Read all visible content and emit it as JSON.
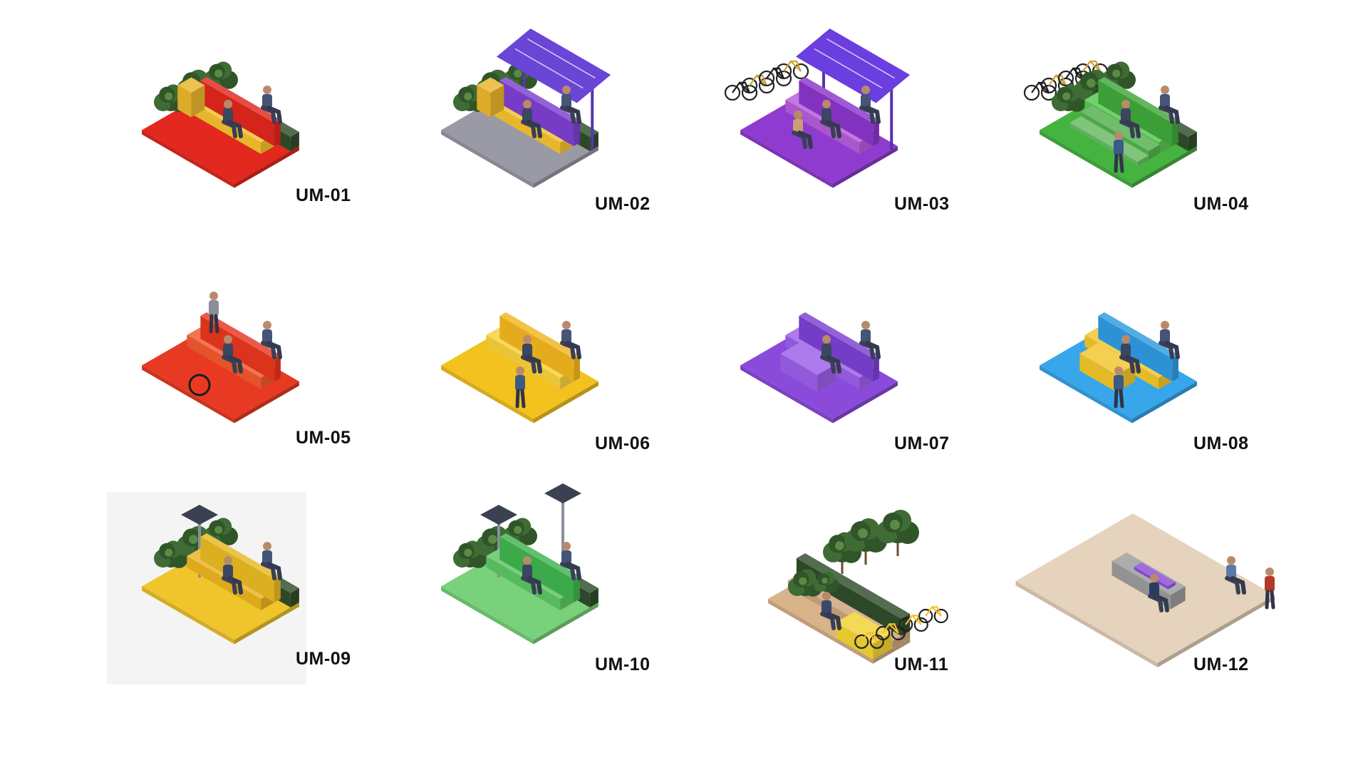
{
  "modules": [
    {
      "code": "UM-01",
      "color": "#e0261c",
      "ground": "#e3281f",
      "accent": "#f2c12e",
      "features": [
        "plants",
        "bench",
        "people"
      ]
    },
    {
      "code": "UM-02",
      "color": "#7c3fcf",
      "ground": "#9a9aa6",
      "accent": "#f2c12e",
      "features": [
        "canopy",
        "plants",
        "bench",
        "people"
      ]
    },
    {
      "code": "UM-03",
      "color": "#8a35c9",
      "ground": "#8f3bd0",
      "accent": "#b35ad8",
      "features": [
        "bicycles",
        "canopy",
        "bench",
        "people"
      ]
    },
    {
      "code": "UM-04",
      "color": "#3fa63a",
      "ground": "#45b33f",
      "accent": "#58c44f",
      "features": [
        "bicycles",
        "plants",
        "steps",
        "people"
      ]
    },
    {
      "code": "UM-05",
      "color": "#e8361f",
      "ground": "#e83a22",
      "accent": "#f0582c",
      "features": [
        "bench",
        "people",
        "wheelchair"
      ]
    },
    {
      "code": "UM-06",
      "color": "#f0b51e",
      "ground": "#f3c21f",
      "accent": "#f6cf3a",
      "features": [
        "bench",
        "people"
      ]
    },
    {
      "code": "UM-07",
      "color": "#7b3fd1",
      "ground": "#8a4bdb",
      "accent": "#9b5ee6",
      "features": [
        "table",
        "bench",
        "people"
      ]
    },
    {
      "code": "UM-08",
      "color": "#2f9ae0",
      "ground": "#37a6ea",
      "accent": "#f1c429",
      "features": [
        "table",
        "bench",
        "people"
      ]
    },
    {
      "code": "UM-09",
      "color": "#e7b822",
      "ground": "#f0c42b",
      "accent": "#e9b21f",
      "features": [
        "lamp",
        "plants",
        "bench",
        "people"
      ]
    },
    {
      "code": "UM-10",
      "color": "#3fb24f",
      "ground": "#79d27b",
      "accent": "#5cc563",
      "features": [
        "lamp",
        "plants",
        "bench",
        "people"
      ]
    },
    {
      "code": "UM-11",
      "color": "#e2c23a",
      "ground": "#d9b48a",
      "accent": "#f1d132",
      "features": [
        "trees",
        "plants",
        "deck",
        "bicycles",
        "people"
      ]
    },
    {
      "code": "UM-12",
      "color": "#8a4bd6",
      "ground": "#e6d3bd",
      "accent": "#9a9a9a",
      "features": [
        "bench",
        "people"
      ]
    }
  ]
}
